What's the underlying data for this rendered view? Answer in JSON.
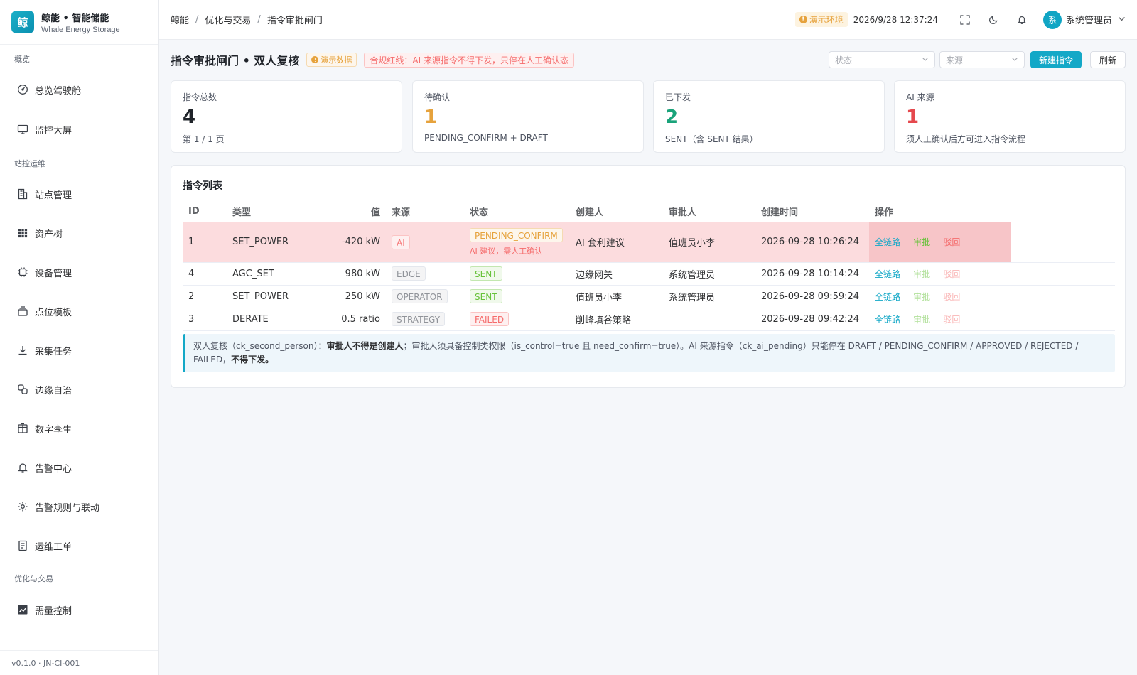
{
  "brand": {
    "logo_char": "鲸",
    "name": "鲸能 • 智能储能",
    "subtitle": "Whale Energy Storage"
  },
  "sidebar": {
    "sections": [
      {
        "label": "概览"
      },
      {
        "label": "站控运维"
      },
      {
        "label": "优化与交易"
      }
    ],
    "items": [
      {
        "label": "总览驾驶舱",
        "icon": "gauge-icon"
      },
      {
        "label": "监控大屏",
        "icon": "monitor-icon"
      },
      {
        "label": "站点管理",
        "icon": "building-icon"
      },
      {
        "label": "资产树",
        "icon": "grid-icon"
      },
      {
        "label": "设备管理",
        "icon": "chip-icon"
      },
      {
        "label": "点位模板",
        "icon": "layers-icon"
      },
      {
        "label": "采集任务",
        "icon": "download-icon"
      },
      {
        "label": "边缘自治",
        "icon": "link-icon"
      },
      {
        "label": "数字孪生",
        "icon": "box-icon"
      },
      {
        "label": "告警中心",
        "icon": "bell-icon"
      },
      {
        "label": "告警规则与联动",
        "icon": "gear-icon"
      },
      {
        "label": "运维工单",
        "icon": "document-icon"
      },
      {
        "label": "需量控制",
        "icon": "chart-icon"
      }
    ],
    "footer": "v0.1.0 · JN-CI-001"
  },
  "header": {
    "breadcrumb": [
      "鲸能",
      "优化与交易",
      "指令审批闸门"
    ],
    "env_badge": "演示环境",
    "datetime": "2026/9/28 12:37:24",
    "user_avatar": "系",
    "user_name": "系统管理员"
  },
  "page": {
    "title": "指令审批闸门 • 双人复核",
    "demo_tag": "演示数据",
    "compliance_tag": "合规红线：AI 来源指令不得下发，只停在人工确认态",
    "filter_status_placeholder": "状态",
    "filter_source_placeholder": "来源",
    "new_button": "新建指令",
    "refresh_button": "刷新"
  },
  "stats": [
    {
      "label": "指令总数",
      "value": "4",
      "sub": "第 1 / 1 页",
      "color": "#1f2329"
    },
    {
      "label": "待确认",
      "value": "1",
      "sub": "PENDING_CONFIRM + DRAFT",
      "color": "#e6a23c"
    },
    {
      "label": "已下发",
      "value": "2",
      "sub": "SENT（含 SENT 结果）",
      "color": "#1aa37a"
    },
    {
      "label": "AI 来源",
      "value": "1",
      "sub": "须人工确认后方可进入指令流程",
      "color": "#e5484d"
    }
  ],
  "table": {
    "title": "指令列表",
    "columns": [
      "ID",
      "类型",
      "值",
      "来源",
      "状态",
      "创建人",
      "审批人",
      "创建时间",
      "操作"
    ],
    "rows": [
      {
        "id": "1",
        "type": "SET_POWER",
        "value": "-420 kW",
        "source": "AI",
        "status": "PENDING_CONFIRM",
        "status_note": "AI 建议，需人工确认",
        "creator": "AI 套利建议",
        "approver": "值班员小李",
        "created": "2026-09-28 10:26:24"
      },
      {
        "id": "4",
        "type": "AGC_SET",
        "value": "980 kW",
        "source": "EDGE",
        "status": "SENT",
        "status_note": "",
        "creator": "边缘网关",
        "approver": "系统管理员",
        "created": "2026-09-28 10:14:24"
      },
      {
        "id": "2",
        "type": "SET_POWER",
        "value": "250 kW",
        "source": "OPERATOR",
        "status": "SENT",
        "status_note": "",
        "creator": "值班员小李",
        "approver": "系统管理员",
        "created": "2026-09-28 09:59:24"
      },
      {
        "id": "3",
        "type": "DERATE",
        "value": "0.5 ratio",
        "source": "STRATEGY",
        "status": "FAILED",
        "status_note": "",
        "creator": "削峰填谷策略",
        "approver": "",
        "created": "2026-09-28 09:42:24"
      }
    ],
    "actions": {
      "trace": "全链路",
      "approve": "审批",
      "reject": "驳回"
    }
  },
  "note": {
    "p1": "双人复核（ck_second_person）：",
    "b1": "审批人不得是创建人",
    "p2": "；审批人须具备控制类权限（is_control=true 且 need_confirm=true）。AI 来源指令（ck_ai_pending）只能停在 DRAFT / PENDING_CONFIRM / APPROVED / REJECTED / FAILED，",
    "b2": "不得下发。"
  }
}
